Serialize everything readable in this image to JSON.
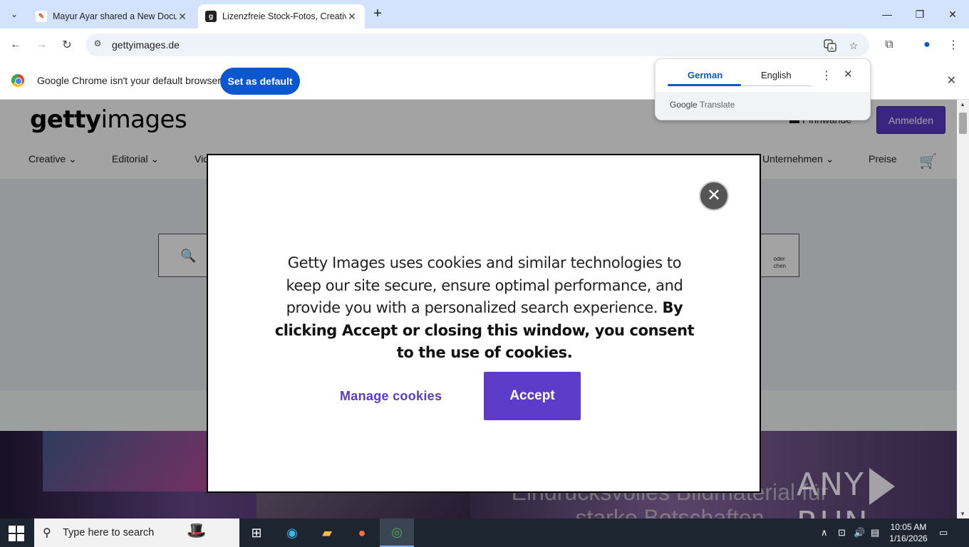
{
  "tabs": [
    {
      "title": "Mayur Ayar shared a New Docu",
      "active": false
    },
    {
      "title": "Lizenzfreie Stock-Fotos, Creativ",
      "active": true
    }
  ],
  "address": {
    "url": "gettyimages.de"
  },
  "infobar": {
    "message": "Google Chrome isn't your default browser",
    "button": "Set as default"
  },
  "translate_popup": {
    "languages": [
      "German",
      "English"
    ],
    "selected": "German",
    "brand_google": "Google",
    "brand_translate": "Translate"
  },
  "site": {
    "logo_bold": "getty",
    "logo_light": "images",
    "boards": "Pinnwände",
    "signin": "Anmelden",
    "nav": [
      {
        "label": "Creative"
      },
      {
        "label": "Editorial"
      },
      {
        "label": "Vid"
      },
      {
        "label": "Unternehmen"
      },
      {
        "label": "Preise"
      }
    ],
    "search_hint_line1": "oder",
    "search_hint_line2": "chen",
    "banner_line1": "Eindrucksvolles Bildmaterial für",
    "banner_line2": "starke Botschaften"
  },
  "cookie_modal": {
    "text_plain": "Getty Images uses cookies and similar technologies to keep our site secure, ensure optimal performance, and provide you with a personalized search experience.",
    "text_bold": "By clicking Accept or closing this window, you consent to the use of cookies.",
    "manage": "Manage cookies",
    "accept": "Accept"
  },
  "watermark": {
    "left": "ANY",
    "right": "RUN"
  },
  "taskbar": {
    "search_placeholder": "Type here to search",
    "time": "10:05 AM",
    "date": "1/16/2026"
  },
  "colors": {
    "chrome_blue": "#0b57d0",
    "getty_purple": "#5c3cc9",
    "tabstrip": "#d3e3fd",
    "taskbar": "#1c2530"
  },
  "icons": [
    "tab-search-icon",
    "close-icon",
    "plus-icon",
    "minimize-icon",
    "maximize-icon",
    "back-icon",
    "forward-icon",
    "reload-icon",
    "site-info-icon",
    "translate-icon",
    "star-icon",
    "extensions-icon",
    "profile-icon",
    "menu-dots-icon",
    "chrome-logo-icon",
    "search-icon",
    "cart-icon",
    "windows-start-icon",
    "task-view-icon",
    "edge-icon",
    "file-explorer-icon",
    "firefox-icon",
    "chrome-icon"
  ]
}
